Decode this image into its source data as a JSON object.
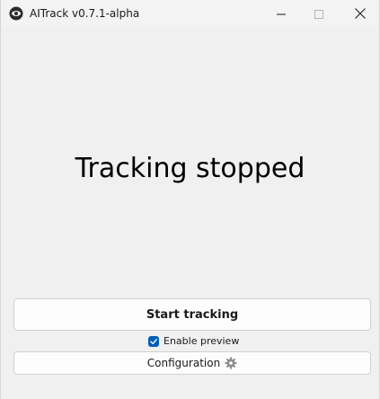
{
  "window": {
    "title": "AITrack v0.7.1-alpha"
  },
  "titlebar": {
    "app_icon": "aitrack-app-icon",
    "minimize_icon": "minimize-icon",
    "maximize_icon": "maximize-icon",
    "close_icon": "close-icon"
  },
  "main": {
    "status_text": "Tracking stopped",
    "start_button_label": "Start tracking",
    "enable_preview_label": "Enable preview",
    "enable_preview_checked": true,
    "configuration_button_label": "Configuration",
    "configuration_icon": "gear-icon"
  },
  "colors": {
    "background": "#f0f0f0",
    "checkbox_accent": "#005fb8",
    "gear_icon": "#8f8f8f"
  }
}
